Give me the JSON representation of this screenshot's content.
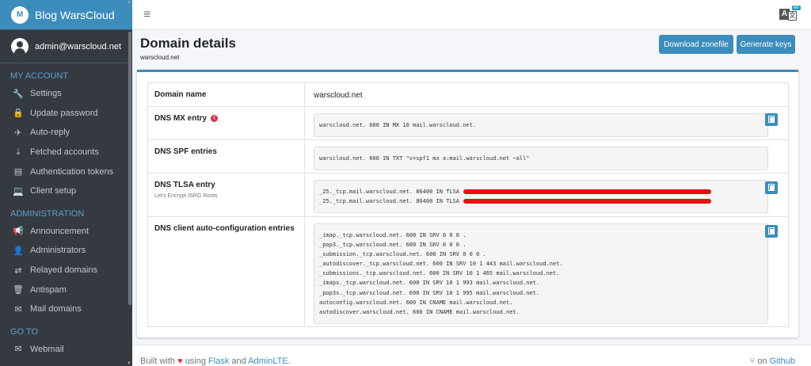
{
  "brand": {
    "title": "Blog WarsCloud"
  },
  "user": {
    "email": "admin@warscloud.net"
  },
  "sidebar": {
    "sections": [
      {
        "header": "MY ACCOUNT",
        "items": [
          {
            "label": "Settings",
            "icon": "wrench-icon"
          },
          {
            "label": "Update password",
            "icon": "lock-icon"
          },
          {
            "label": "Auto-reply",
            "icon": "plane-icon"
          },
          {
            "label": "Fetched accounts",
            "icon": "download-icon"
          },
          {
            "label": "Authentication tokens",
            "icon": "ticket-icon"
          },
          {
            "label": "Client setup",
            "icon": "laptop-icon"
          }
        ]
      },
      {
        "header": "ADMINISTRATION",
        "items": [
          {
            "label": "Announcement",
            "icon": "bullhorn-icon"
          },
          {
            "label": "Administrators",
            "icon": "user-icon"
          },
          {
            "label": "Relayed domains",
            "icon": "exchange-icon"
          },
          {
            "label": "Antispam",
            "icon": "trash-icon"
          },
          {
            "label": "Mail domains",
            "icon": "envelope-icon"
          }
        ]
      },
      {
        "header": "GO TO",
        "items": [
          {
            "label": "Webmail",
            "icon": "envelope-open-icon"
          }
        ]
      }
    ]
  },
  "topnav": {
    "lang_badge": "en",
    "lang_left": "A",
    "lang_right": "文"
  },
  "header": {
    "title": "Domain details",
    "subtitle": "warscloud.net",
    "download_label": "Download zonefile",
    "generate_label": "Generate keys"
  },
  "details": {
    "domain_name": {
      "label": "Domain name",
      "value": "warscloud.net"
    },
    "mx": {
      "label": "DNS MX entry",
      "value": "warscloud.net. 600 IN MX 10 mail.warscloud.net."
    },
    "spf": {
      "label": "DNS SPF entries",
      "value": "warscloud.net. 600 IN TXT \"v=spf1 mx a:mail.warscloud.net ~all\""
    },
    "tlsa": {
      "label": "DNS TLSA entry",
      "sublabel": "Let's Encrypt ISRG Roots",
      "lines": [
        "_25._tcp.mail.warscloud.net. 86400 IN TLSA ",
        "_25._tcp.mail.warscloud.net. 86400 IN TLSA "
      ]
    },
    "autoconfig": {
      "label": "DNS client auto-configuration entries",
      "lines": [
        "_imap._tcp.warscloud.net. 600 IN SRV 0 0 0 .",
        "_pop3._tcp.warscloud.net. 600 IN SRV 0 0 0 .",
        "_submission._tcp.warscloud.net. 600 IN SRV 0 0 0 .",
        "_autodiscover._tcp.warscloud.net. 600 IN SRV 10 1 443 mail.warscloud.net.",
        "_submissions._tcp.warscloud.net. 600 IN SRV 10 1 465 mail.warscloud.net.",
        "_imaps._tcp.warscloud.net. 600 IN SRV 10 1 993 mail.warscloud.net.",
        "_pop3s._tcp.warscloud.net. 600 IN SRV 10 1 995 mail.warscloud.net.",
        "autoconfig.warscloud.net. 600 IN CNAME mail.warscloud.net.",
        "autodiscover.warscloud.net. 600 IN CNAME mail.warscloud.net."
      ]
    }
  },
  "footer": {
    "built_with": "Built with",
    "using": "using",
    "flask": "Flask",
    "and": "and",
    "adminlte": "AdminLTE.",
    "on": "on",
    "github": "Github"
  },
  "colors": {
    "primary": "#3c8dbc",
    "sidebar": "#343a40",
    "danger": "#dc3545"
  }
}
